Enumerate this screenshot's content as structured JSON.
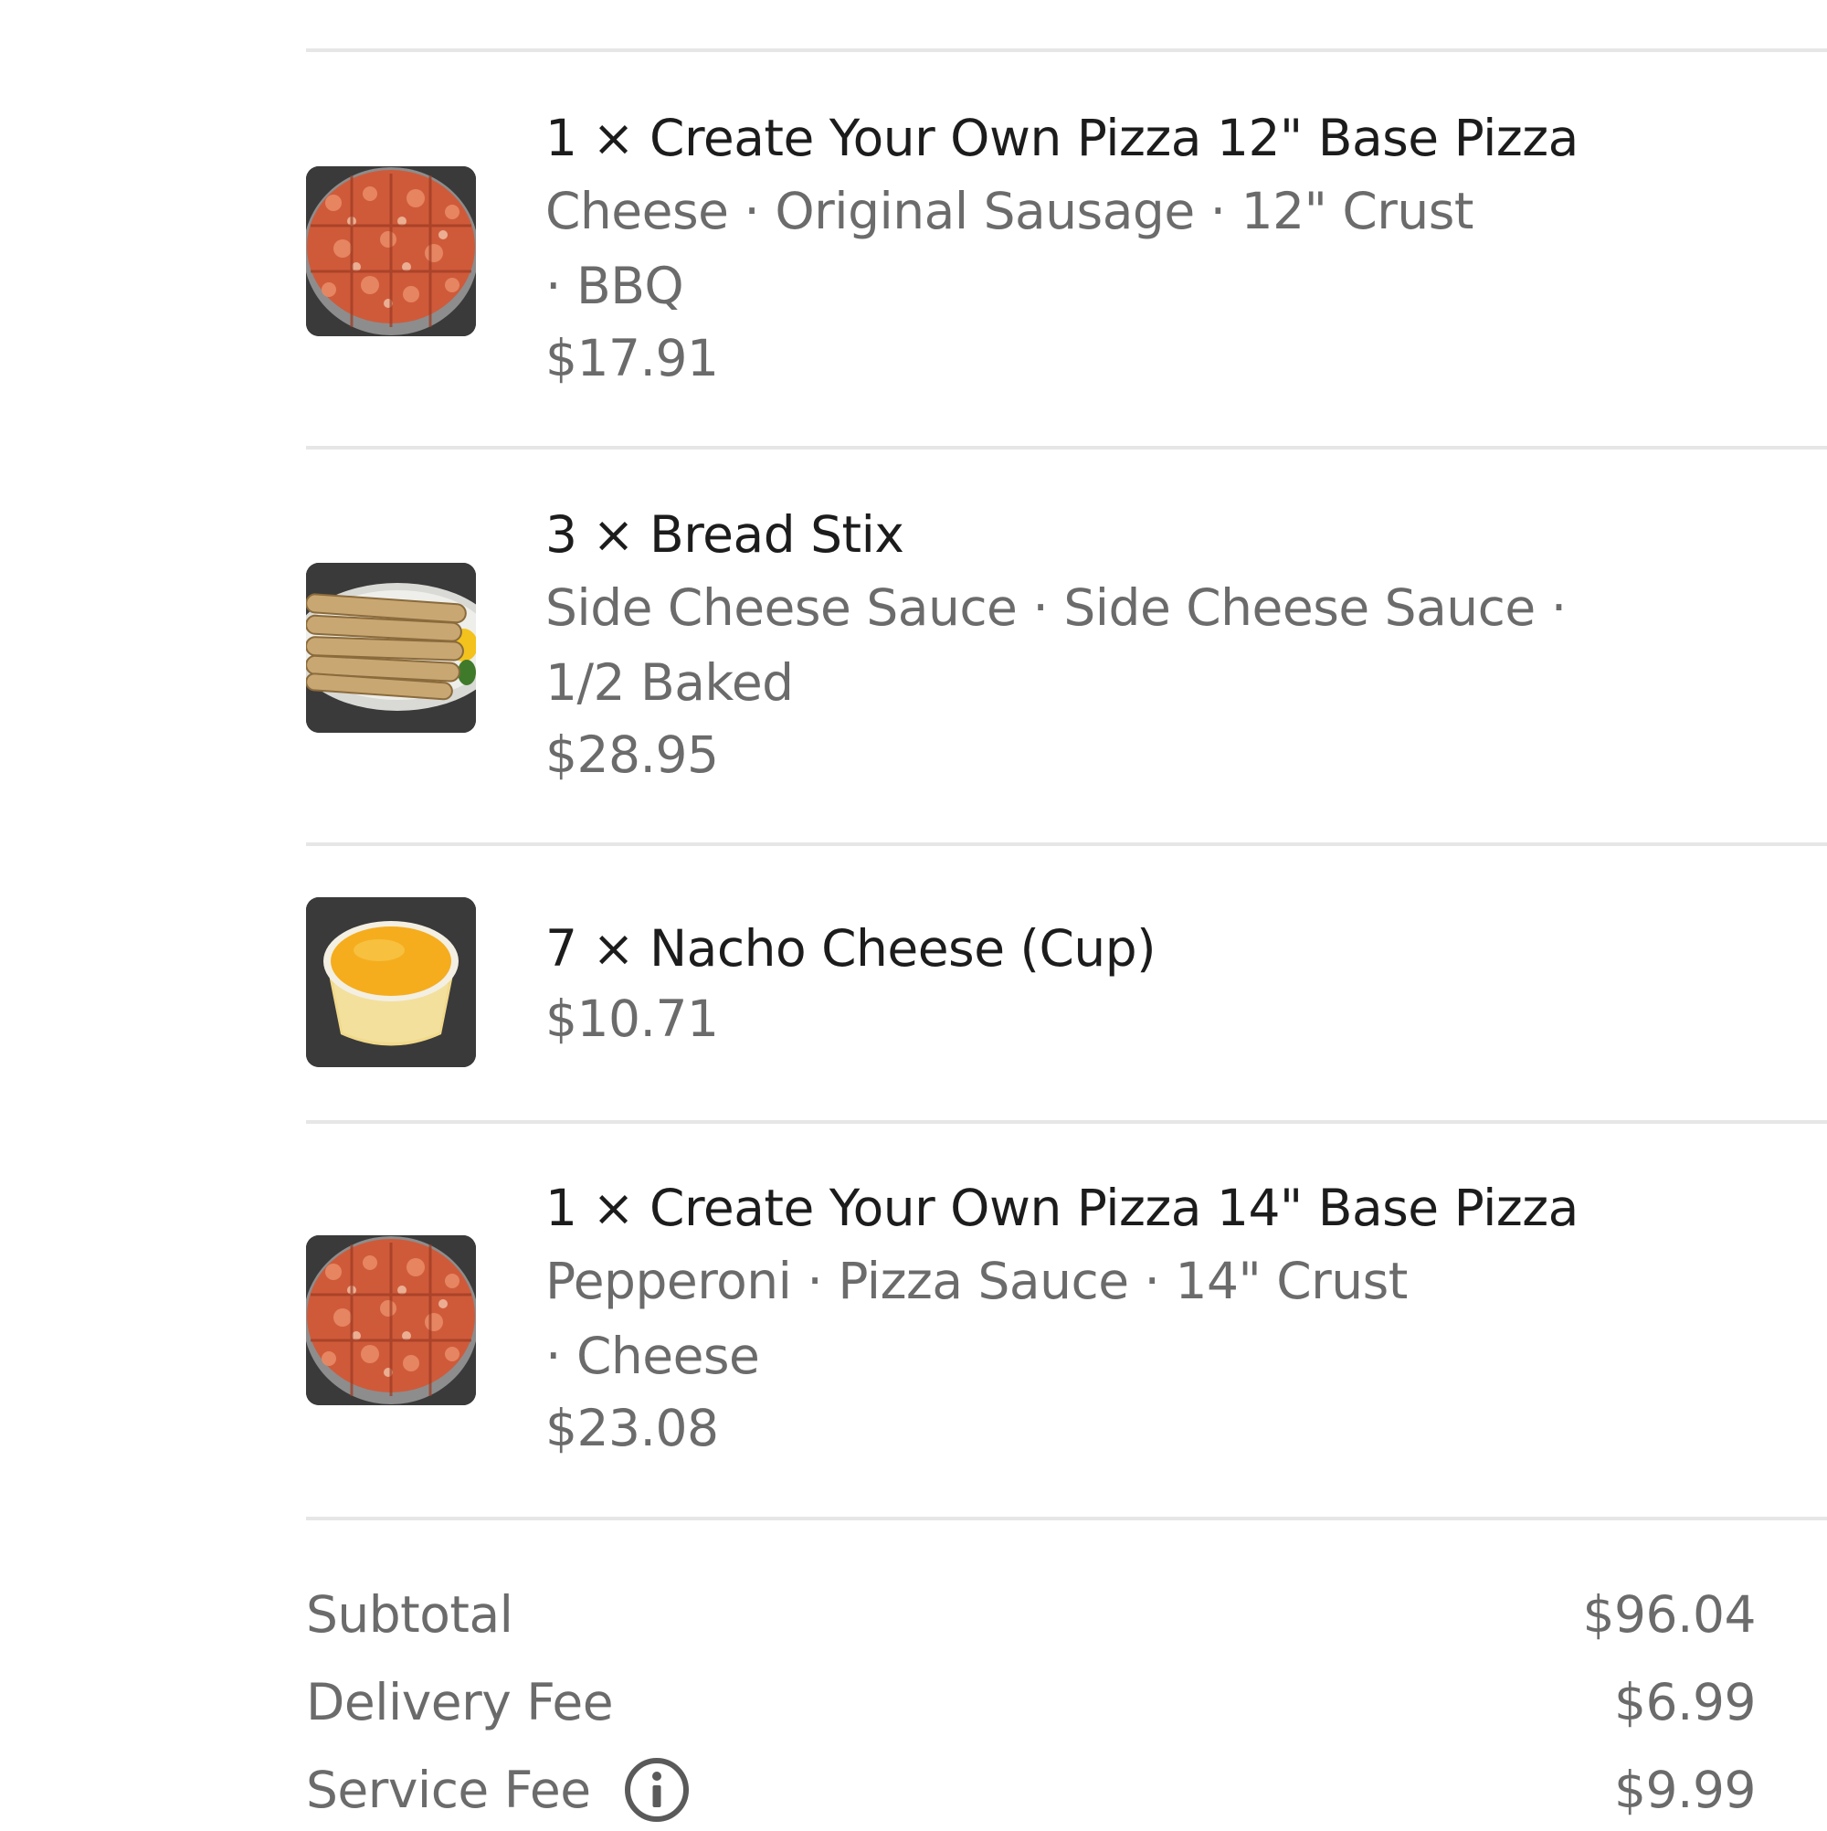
{
  "items": [
    {
      "title": "1 × Create Your Own Pizza 12\" Base Pizza",
      "desc_lines": [
        "Cheese · Original Sausage · 12\" Crust",
        "· BBQ"
      ],
      "price": "$17.91",
      "image": "pizza-image"
    },
    {
      "title": "3 × Bread Stix",
      "desc_lines": [
        "Side Cheese Sauce · Side Cheese Sauce ·",
        "1/2 Baked"
      ],
      "price": "$28.95",
      "image": "breadsticks-image"
    },
    {
      "title": "7 × Nacho Cheese (Cup)",
      "desc_lines": [],
      "price": "$10.71",
      "image": "nacho-cheese-cup-image"
    },
    {
      "title": "1 × Create Your Own Pizza 14\" Base Pizza",
      "desc_lines": [
        "Pepperoni · Pizza Sauce · 14\" Crust",
        "· Cheese"
      ],
      "price": "$23.08",
      "image": "pizza-image"
    }
  ],
  "summary": {
    "subtotal_label": "Subtotal",
    "subtotal_value": "$96.04",
    "delivery_label": "Delivery Fee",
    "delivery_value": "$6.99",
    "service_label": "Service Fee",
    "service_value": "$9.99",
    "service_icon": "info-icon"
  }
}
